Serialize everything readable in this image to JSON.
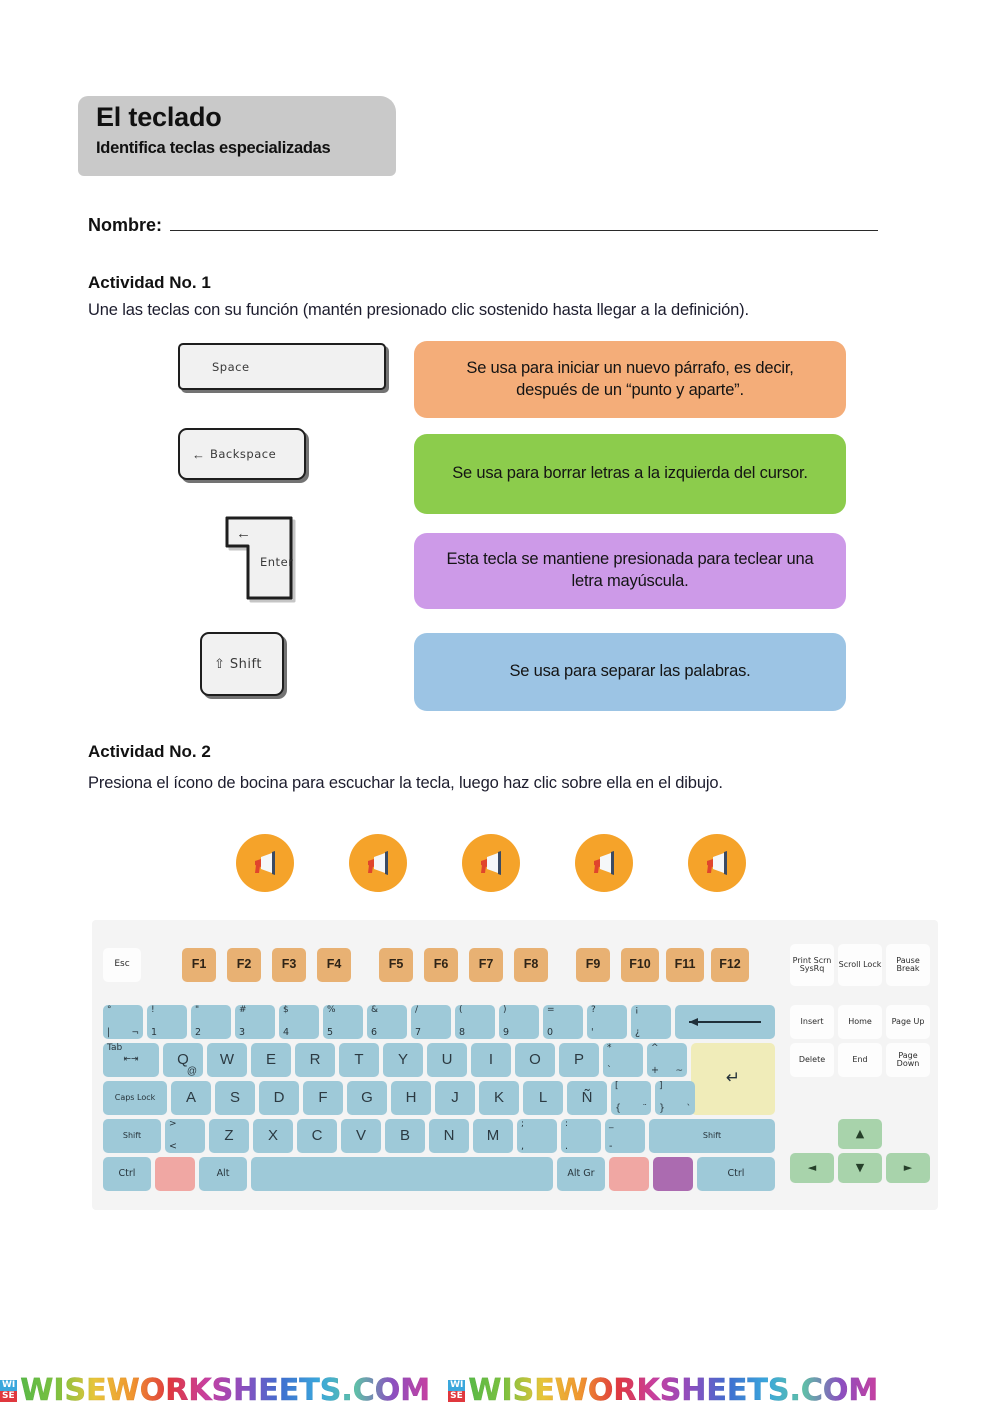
{
  "header": {
    "title": "El teclado",
    "subtitle": "Identifica teclas especializadas",
    "banner_color": "#c9c9c9"
  },
  "name_field": {
    "label": "Nombre:",
    "value": ""
  },
  "activity1": {
    "heading": "Actividad No. 1",
    "instructions": "Une las teclas con su función (mantén presionado clic sostenido hasta llegar a la definición).",
    "keys": [
      {
        "id": "space",
        "label": "Space",
        "glyph": ""
      },
      {
        "id": "backspace",
        "label": "Backspace",
        "glyph": "←"
      },
      {
        "id": "enter",
        "label": "Enter",
        "glyph": "←"
      },
      {
        "id": "shift",
        "label": "Shift",
        "glyph": "⇧"
      }
    ],
    "definitions": [
      {
        "text": "Se usa para iniciar un nuevo párrafo, es decir, después de un “punto y aparte”.",
        "color": "#f4ad79"
      },
      {
        "text": "Se usa para borrar letras a la izquierda del cursor.",
        "color": "#8ccc4c"
      },
      {
        "text": "Esta tecla se mantiene presionada para teclear una letra mayúscula.",
        "color": "#cd9ae8"
      },
      {
        "text": "Se usa para separar las palabras.",
        "color": "#9cc4e4"
      }
    ]
  },
  "activity2": {
    "heading": "Actividad No. 2",
    "instructions": "Presiona el ícono de bocina para escuchar la tecla, luego haz clic sobre ella en el dibujo.",
    "speakers": [
      {
        "icon": "megaphone-icon"
      },
      {
        "icon": "megaphone-icon"
      },
      {
        "icon": "megaphone-icon"
      },
      {
        "icon": "megaphone-icon"
      },
      {
        "icon": "megaphone-icon"
      }
    ],
    "speaker_color": "#f5a32a"
  },
  "keyboard": {
    "colors": {
      "body": "#f4f4f4",
      "blue": "#9ec9d8",
      "orange": "#e8b173",
      "green": "#a8d3ab",
      "white": "#fdfdfd",
      "yellow": "#f0ecb9",
      "pink": "#f0a7a3",
      "purple": "#ab6bb0"
    },
    "row_function": [
      {
        "label": "Esc",
        "color": "white"
      },
      {
        "label": "F1",
        "color": "orange"
      },
      {
        "label": "F2",
        "color": "orange"
      },
      {
        "label": "F3",
        "color": "orange"
      },
      {
        "label": "F4",
        "color": "orange"
      },
      {
        "label": "F5",
        "color": "orange"
      },
      {
        "label": "F6",
        "color": "orange"
      },
      {
        "label": "F7",
        "color": "orange"
      },
      {
        "label": "F8",
        "color": "orange"
      },
      {
        "label": "F9",
        "color": "orange"
      },
      {
        "label": "F10",
        "color": "orange"
      },
      {
        "label": "F11",
        "color": "orange"
      },
      {
        "label": "F12",
        "color": "orange"
      }
    ],
    "row_sysblock": [
      {
        "label": "Print Scrn SysRq",
        "color": "white"
      },
      {
        "label": "Scroll Lock",
        "color": "white"
      },
      {
        "label": "Pause Break",
        "color": "white"
      }
    ],
    "row_numbers": [
      {
        "top": "°",
        "bottom": "|",
        "extra": "¬"
      },
      {
        "top": "!",
        "bottom": "1"
      },
      {
        "top": "\"",
        "bottom": "2"
      },
      {
        "top": "#",
        "bottom": "3"
      },
      {
        "top": "$",
        "bottom": "4"
      },
      {
        "top": "%",
        "bottom": "5"
      },
      {
        "top": "&",
        "bottom": "6"
      },
      {
        "top": "/",
        "bottom": "7"
      },
      {
        "top": "(",
        "bottom": "8"
      },
      {
        "top": ")",
        "bottom": "9"
      },
      {
        "top": "=",
        "bottom": "0"
      },
      {
        "top": "?",
        "bottom": "'"
      },
      {
        "top": "¡",
        "bottom": "¿"
      },
      {
        "label": "backspace-arrow",
        "color": "blue"
      }
    ],
    "row_qwerty": [
      {
        "label": "Tab"
      },
      {
        "label": "Q",
        "sub": "@"
      },
      {
        "label": "W"
      },
      {
        "label": "E"
      },
      {
        "label": "R"
      },
      {
        "label": "T"
      },
      {
        "label": "Y"
      },
      {
        "label": "U"
      },
      {
        "label": "I"
      },
      {
        "label": "O"
      },
      {
        "label": "P"
      },
      {
        "top": "*",
        "bottom": "`"
      },
      {
        "top": "^",
        "bottom": "+",
        "extra": "~"
      },
      {
        "label": "Enter",
        "color": "yellow"
      }
    ],
    "row_home": [
      {
        "label": "Caps Lock"
      },
      {
        "label": "A"
      },
      {
        "label": "S"
      },
      {
        "label": "D"
      },
      {
        "label": "F"
      },
      {
        "label": "G"
      },
      {
        "label": "H"
      },
      {
        "label": "J"
      },
      {
        "label": "K"
      },
      {
        "label": "L"
      },
      {
        "label": "Ñ"
      },
      {
        "top": "[",
        "bottom": "{",
        "extra": "¨"
      },
      {
        "top": "]",
        "bottom": "}",
        "extra": "`"
      }
    ],
    "row_shift": [
      {
        "label": "Shift"
      },
      {
        "top": ">",
        "bottom": "<"
      },
      {
        "label": "Z"
      },
      {
        "label": "X"
      },
      {
        "label": "C"
      },
      {
        "label": "V"
      },
      {
        "label": "B"
      },
      {
        "label": "N"
      },
      {
        "label": "M"
      },
      {
        "top": ";",
        "bottom": ","
      },
      {
        "top": ":",
        "bottom": "."
      },
      {
        "top": "_",
        "bottom": "-"
      },
      {
        "label": "Shift"
      }
    ],
    "row_bottom": [
      {
        "label": "Ctrl",
        "color": "blue"
      },
      {
        "label": "",
        "color": "pink"
      },
      {
        "label": "Alt",
        "color": "blue"
      },
      {
        "label": "",
        "color": "blue"
      },
      {
        "label": "Alt Gr",
        "color": "blue"
      },
      {
        "label": "",
        "color": "pink"
      },
      {
        "label": "",
        "color": "purple"
      },
      {
        "label": "Ctrl",
        "color": "blue"
      }
    ],
    "nav_block": [
      {
        "label": "Insert",
        "color": "white"
      },
      {
        "label": "Home",
        "color": "white"
      },
      {
        "label": "Page Up",
        "color": "white"
      },
      {
        "label": "Delete",
        "color": "white"
      },
      {
        "label": "End",
        "color": "white"
      },
      {
        "label": "Page Down",
        "color": "white"
      }
    ],
    "arrow_keys": [
      {
        "label": "▲",
        "name": "arrow-up-key"
      },
      {
        "label": "◄",
        "name": "arrow-left-key"
      },
      {
        "label": "▼",
        "name": "arrow-down-key"
      },
      {
        "label": "►",
        "name": "arrow-right-key"
      }
    ]
  },
  "footer": {
    "watermark": "WISEWORKSHEETS.COM",
    "badge_top": "WI",
    "badge_bottom": "SE"
  }
}
